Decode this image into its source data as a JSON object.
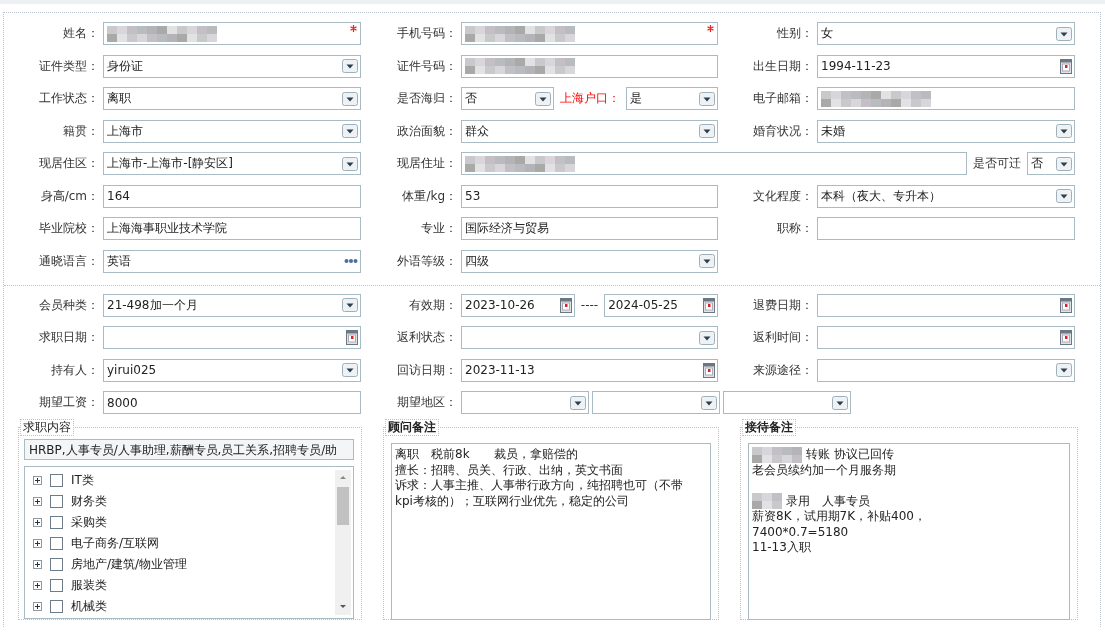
{
  "sections": [
    {
      "rows": [
        [
          {
            "label": "姓名：",
            "fields": [
              {
                "kind": "text",
                "redacted": true,
                "required": true
              }
            ]
          },
          {
            "label": "手机号码：",
            "fields": [
              {
                "kind": "text",
                "redacted": true,
                "required": true
              }
            ]
          },
          {
            "label": "性别：",
            "fields": [
              {
                "kind": "select",
                "value": "女",
                "redacted": false,
                "required": false
              }
            ]
          }
        ],
        [
          {
            "label": "证件类型：",
            "fields": [
              {
                "kind": "select",
                "value": "身份证",
                "redacted": false,
                "required": false
              }
            ]
          },
          {
            "label": "证件号码：",
            "fields": [
              {
                "kind": "text",
                "redacted": true,
                "required": false
              }
            ]
          },
          {
            "label": "出生日期：",
            "fields": [
              {
                "kind": "date",
                "value": "1994-11-23",
                "redacted": false,
                "required": false
              }
            ]
          }
        ],
        [
          {
            "label": "工作状态：",
            "fields": [
              {
                "kind": "select",
                "value": "离职",
                "redacted": false,
                "required": false
              }
            ]
          },
          {
            "label": "是否海归：",
            "fields": [
              {
                "kind": "select",
                "value": "否",
                "redacted": false,
                "required": false
              },
              {
                "kind": "label",
                "text": "上海户口：",
                "emphasis": true
              },
              {
                "kind": "select",
                "value": "是",
                "redacted": false,
                "required": false
              }
            ]
          },
          {
            "label": "电子邮箱：",
            "fields": [
              {
                "kind": "text",
                "redacted": true,
                "required": false
              }
            ]
          }
        ],
        [
          {
            "label": "籍贯：",
            "fields": [
              {
                "kind": "select",
                "value": "上海市",
                "redacted": false,
                "required": false
              }
            ]
          },
          {
            "label": "政治面貌：",
            "fields": [
              {
                "kind": "select",
                "value": "群众",
                "redacted": false,
                "required": false
              }
            ]
          },
          {
            "label": "婚育状况：",
            "fields": [
              {
                "kind": "select",
                "value": "未婚",
                "redacted": false,
                "required": false
              }
            ]
          }
        ],
        [
          {
            "label": "现居住区：",
            "fields": [
              {
                "kind": "select",
                "value": "上海市-上海市-[静安区]",
                "redacted": false,
                "required": false
              }
            ]
          },
          {
            "label": "现居住址：",
            "fields": [
              {
                "kind": "text",
                "redacted": true,
                "required": false
              },
              {
                "kind": "label",
                "text": "是否可迁",
                "emphasis": false
              },
              {
                "kind": "select",
                "value": "否",
                "redacted": false,
                "required": false
              }
            ]
          }
        ],
        [
          {
            "label": "身高/cm：",
            "fields": [
              {
                "kind": "text",
                "value": "164",
                "redacted": false,
                "required": false
              }
            ]
          },
          {
            "label": "体重/kg：",
            "fields": [
              {
                "kind": "text",
                "value": "53",
                "redacted": false,
                "required": false
              }
            ]
          },
          {
            "label": "文化程度：",
            "fields": [
              {
                "kind": "select",
                "value": "本科（夜大、专升本）",
                "redacted": false,
                "required": false
              }
            ]
          }
        ],
        [
          {
            "label": "毕业院校：",
            "fields": [
              {
                "kind": "text",
                "value": "上海海事职业技术学院",
                "redacted": false,
                "required": false
              }
            ]
          },
          {
            "label": "专业：",
            "fields": [
              {
                "kind": "text",
                "value": "国际经济与贸易",
                "redacted": false,
                "required": false
              }
            ]
          },
          {
            "label": "职称：",
            "fields": [
              {
                "kind": "text",
                "redacted": false,
                "required": false
              }
            ]
          }
        ],
        [
          {
            "label": "通晓语言：",
            "fields": [
              {
                "kind": "lookup",
                "value": "英语",
                "redacted": false,
                "required": false
              }
            ]
          },
          {
            "label": "外语等级：",
            "fields": [
              {
                "kind": "select",
                "value": "四级",
                "redacted": false,
                "required": false
              }
            ]
          },
          null
        ]
      ]
    },
    {
      "rows": [
        [
          {
            "label": "会员种类：",
            "fields": [
              {
                "kind": "select",
                "value": "21-498加一个月",
                "redacted": false,
                "required": false
              }
            ]
          },
          {
            "label": "有效期：",
            "fields": [
              {
                "kind": "date",
                "value": "2023-10-26",
                "redacted": false,
                "required": false
              },
              {
                "kind": "label",
                "text": "----",
                "emphasis": false
              },
              {
                "kind": "date",
                "value": "2024-05-25",
                "redacted": false,
                "required": false
              }
            ]
          },
          {
            "label": "退费日期：",
            "fields": [
              {
                "kind": "date",
                "redacted": false,
                "required": false
              }
            ]
          }
        ],
        [
          {
            "label": "求职日期：",
            "fields": [
              {
                "kind": "date",
                "redacted": false,
                "required": false
              }
            ]
          },
          {
            "label": "返利状态：",
            "fields": [
              {
                "kind": "select",
                "redacted": false,
                "required": false
              }
            ]
          },
          {
            "label": "返利时间：",
            "fields": [
              {
                "kind": "date",
                "redacted": false,
                "required": false
              }
            ]
          }
        ],
        [
          {
            "label": "持有人：",
            "fields": [
              {
                "kind": "select",
                "value": "yirui025",
                "redacted": false,
                "required": false
              }
            ]
          },
          {
            "label": "回访日期：",
            "fields": [
              {
                "kind": "date",
                "value": "2023-11-13",
                "redacted": false,
                "required": false
              }
            ]
          },
          {
            "label": "来源途径：",
            "fields": [
              {
                "kind": "select",
                "redacted": false,
                "required": false
              }
            ]
          }
        ],
        [
          {
            "label": "期望工资：",
            "fields": [
              {
                "kind": "text",
                "value": "8000",
                "redacted": false,
                "required": false
              }
            ]
          },
          {
            "label": "期望地区：",
            "fields": [
              {
                "kind": "select",
                "redacted": false,
                "required": false
              },
              {
                "kind": "select",
                "redacted": false,
                "required": false
              },
              {
                "kind": "select",
                "redacted": false,
                "required": false
              }
            ]
          }
        ]
      ]
    }
  ],
  "panels": [
    {
      "kind": "job_tree",
      "title": "求职内容",
      "summary": "HRBP,人事专员/人事助理,薪酬专员,员工关系,招聘专员/助",
      "items": [
        {
          "label": "IT类",
          "expanded": false,
          "checked": false
        },
        {
          "label": "财务类",
          "expanded": false,
          "checked": false
        },
        {
          "label": "采购类",
          "expanded": false,
          "checked": false
        },
        {
          "label": "电子商务/互联网",
          "expanded": false,
          "checked": false
        },
        {
          "label": "房地产/建筑/物业管理",
          "expanded": false,
          "checked": false
        },
        {
          "label": "服装类",
          "expanded": false,
          "checked": false
        },
        {
          "label": "机械类",
          "expanded": false,
          "checked": false
        }
      ]
    },
    {
      "kind": "notes",
      "title": "顾问备注",
      "paragraphs": [
        [
          {
            "text": "离职　税前8k　　裁员，拿赔偿的",
            "redacted_prefix": false
          },
          {
            "text": "擅长：招聘、员关、行政、出纳，英文书面",
            "redacted_prefix": false
          },
          {
            "text": "诉求：人事主推、人事带行政方向，纯招聘也可（不带",
            "redacted_prefix": false
          },
          {
            "text": "kpi考核的）；互联网行业优先，稳定的公司",
            "redacted_prefix": false
          }
        ]
      ]
    },
    {
      "kind": "notes",
      "title": "接待备注",
      "paragraphs": [
        [
          {
            "text": "转账 协议已回传",
            "redacted_prefix": true
          },
          {
            "text": "老会员续约加一个月服务期",
            "redacted_prefix": false
          }
        ],
        [
          {
            "text": "录用　人事专员",
            "redacted_prefix": true
          },
          {
            "text": "薪资8K，试用期7K，补贴400，",
            "redacted_prefix": false
          },
          {
            "text": "7400*0.7=5180",
            "redacted_prefix": false
          },
          {
            "text": "11-13入职",
            "redacted_prefix": false
          }
        ]
      ]
    }
  ]
}
